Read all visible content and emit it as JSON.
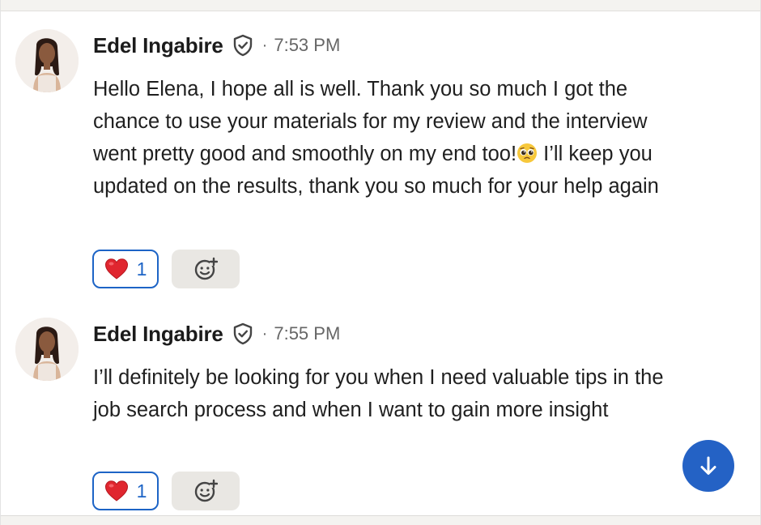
{
  "messages": [
    {
      "sender": "Edel Ingabire",
      "separator": "·",
      "time": "7:53 PM",
      "text_before_emoji": "Hello Elena, I hope all is well. Thank you so much I got the chance to use your materials for my review and the interview went pretty good and smoothly on my end too!",
      "emoji": "pleading-face-emoji",
      "text_after_emoji": " I’ll keep you updated on the results, thank you so much for your help again",
      "reaction": {
        "icon": "red-heart-icon",
        "count": "1"
      }
    },
    {
      "sender": "Edel Ingabire",
      "separator": "·",
      "time": "7:55 PM",
      "text": "I’ll definitely be looking for you when I need valuable tips in the job search process and when I want to gain more insight",
      "reaction": {
        "icon": "red-heart-icon",
        "count": "1"
      }
    }
  ],
  "icons": {
    "verified": "shield-check-icon",
    "add_reaction": "add-reaction-icon",
    "scroll_down": "arrow-down-icon"
  },
  "colors": {
    "accent": "#1d64c6",
    "scroll_button": "#2462c5",
    "heart": "#e0262f",
    "chip_bg": "#e9e7e3"
  }
}
